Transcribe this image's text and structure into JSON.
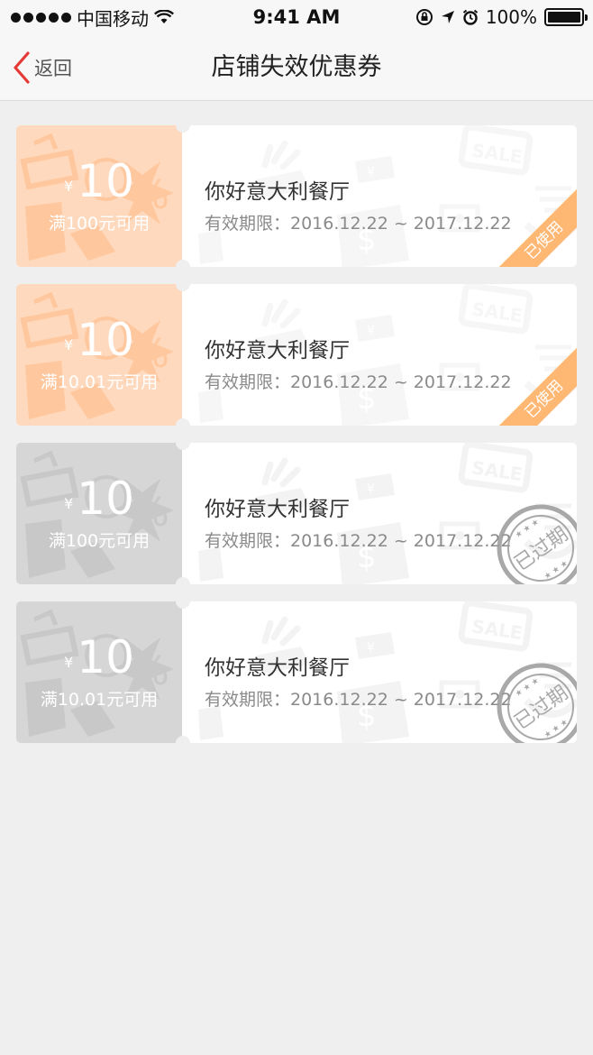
{
  "status_bar": {
    "carrier": "中国移动",
    "time": "9:41 AM",
    "battery": "100%",
    "battery_level": 1.0
  },
  "nav": {
    "back_label": "返回",
    "title": "店铺失效优惠券"
  },
  "coupons": [
    {
      "currency": "¥",
      "amount": "10",
      "condition": "满100元可用",
      "shop": "你好意大利餐厅",
      "validity": "有效期限：2016.12.22 ~ 2017.12.22",
      "status": "已使用",
      "state": "used"
    },
    {
      "currency": "¥",
      "amount": "10",
      "condition": "满10.01元可用",
      "shop": "你好意大利餐厅",
      "validity": "有效期限：2016.12.22 ~ 2017.12.22",
      "status": "已使用",
      "state": "used"
    },
    {
      "currency": "¥",
      "amount": "10",
      "condition": "满100元可用",
      "shop": "你好意大利餐厅",
      "validity": "有效期限：2016.12.22 ~ 2017.12.22",
      "status": "已过期",
      "state": "expired"
    },
    {
      "currency": "¥",
      "amount": "10",
      "condition": "满10.01元可用",
      "shop": "你好意大利餐厅",
      "validity": "有效期限：2016.12.22 ~ 2017.12.22",
      "status": "已过期",
      "state": "expired"
    }
  ],
  "colors": {
    "accent": "#e53935",
    "used_left_bg": "#ffd9bd",
    "expired_left_bg": "#d6d6d6",
    "used_ribbon": "#ffb874"
  }
}
